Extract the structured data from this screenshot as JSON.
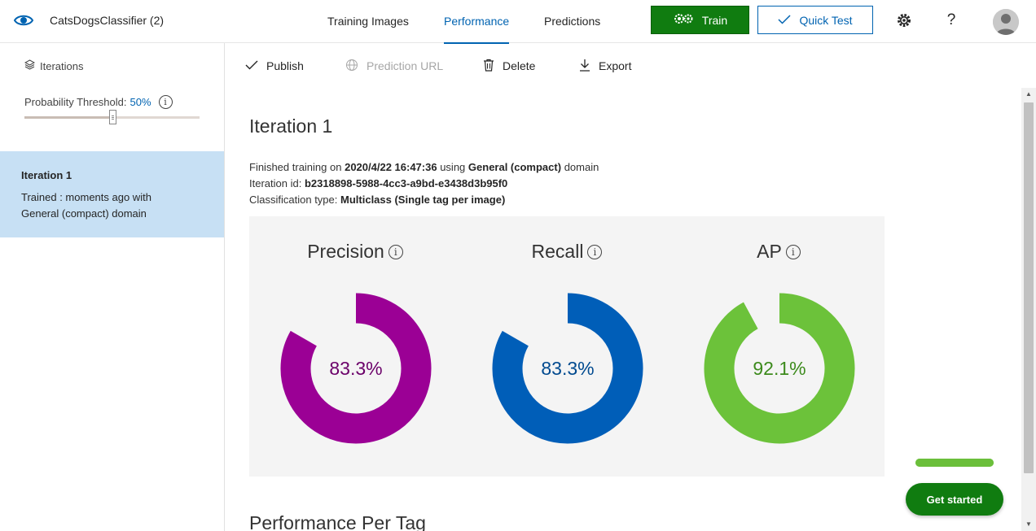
{
  "header": {
    "project_name": "CatsDogsClassifier (2)",
    "tabs": [
      {
        "label": "Training Images",
        "active": false
      },
      {
        "label": "Performance",
        "active": true
      },
      {
        "label": "Predictions",
        "active": false
      }
    ],
    "train_label": "Train",
    "quick_test_label": "Quick Test",
    "settings_icon": "gear-icon",
    "help_label": "?",
    "avatar_icon": "user-avatar-icon"
  },
  "sidebar": {
    "iterations_label": "Iterations",
    "probability_label": "Probability Threshold:",
    "probability_value": "50%",
    "probability_fraction": 0.5,
    "iterations": [
      {
        "title": "Iteration 1",
        "desc_line1": "Trained : moments ago with",
        "desc_line2": "General (compact) domain",
        "selected": true
      }
    ]
  },
  "toolbar": {
    "publish_label": "Publish",
    "prediction_url_label": "Prediction URL",
    "delete_label": "Delete",
    "export_label": "Export"
  },
  "main": {
    "title": "Iteration 1",
    "finished_prefix": "Finished training on",
    "finished_date": "2020/4/22 16:47:36",
    "finished_using": "using",
    "finished_domain": "General (compact)",
    "finished_suffix": "domain",
    "iteration_id_label": "Iteration id:",
    "iteration_id": "b2318898-5988-4cc3-a9bd-e3438d3b95f0",
    "classification_label": "Classification type:",
    "classification_value": "Multiclass (Single tag per image)",
    "metrics": [
      {
        "name": "Precision",
        "value_text": "83.3%",
        "value": 0.833,
        "color": "#9b0095",
        "text_color": "#6b0069"
      },
      {
        "name": "Recall",
        "value_text": "83.3%",
        "value": 0.833,
        "color": "#005eb8",
        "text_color": "#004a8f"
      },
      {
        "name": "AP",
        "value_text": "92.1%",
        "value": 0.921,
        "color": "#6cc23a",
        "text_color": "#3c8a1c"
      }
    ],
    "per_tag_title": "Performance Per Tag"
  },
  "get_started": {
    "progress": 1.0,
    "label": "Get started"
  },
  "colors": {
    "accent": "#0063b1",
    "train_green": "#107c10",
    "selected_bg": "#c7e0f4"
  }
}
